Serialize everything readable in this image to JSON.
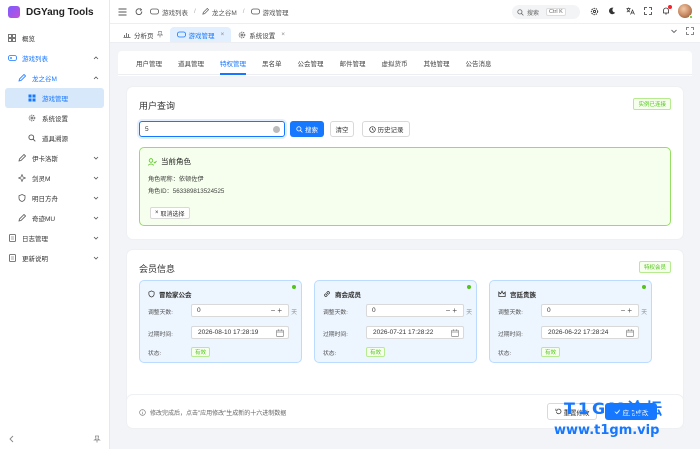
{
  "app": {
    "name": "DGYang Tools"
  },
  "sidebar": {
    "items": [
      {
        "label": "概览"
      },
      {
        "label": "游戏列表"
      },
      {
        "label": "龙之谷M"
      },
      {
        "label": "游戏管理"
      },
      {
        "label": "系统设置"
      },
      {
        "label": "道具溯源"
      },
      {
        "label": "伊卡洛斯"
      },
      {
        "label": "剑灵M"
      },
      {
        "label": "明日方舟"
      },
      {
        "label": "奇迹MU"
      },
      {
        "label": "日志管理"
      },
      {
        "label": "更新说明"
      }
    ]
  },
  "header": {
    "breadcrumb": [
      "游戏列表",
      "龙之谷M",
      "游戏管理"
    ],
    "search": {
      "label": "搜索",
      "shortcut": "Ctrl K"
    }
  },
  "tabs": [
    {
      "label": "分析页"
    },
    {
      "label": "游戏管理"
    },
    {
      "label": "系统设置"
    }
  ],
  "subtabs": [
    "用户管理",
    "道具管理",
    "特权管理",
    "黑名单",
    "公会管理",
    "邮件管理",
    "虚拟货币",
    "其他管理",
    "公告消息"
  ],
  "user_query": {
    "title": "用户查询",
    "badge": "实例已连接",
    "input_value": "5",
    "search_label": "搜索",
    "clear_label": "清空",
    "history_label": "历史记录",
    "current_role": {
      "title": "当前角色",
      "name_line": "角色昵称：依顿佐伊",
      "id_line": "角色ID：563389813524525",
      "cancel_label": "取消选择"
    }
  },
  "member": {
    "title": "会员信息",
    "badge": "特权会员",
    "adjust_label": "调整天数:",
    "expire_label": "过期时间:",
    "status_label": "状态:",
    "unit": "天",
    "cards": [
      {
        "title": "冒险家公会",
        "days": "0",
        "expire": "2026-08-10 17:28:19",
        "status": "有效"
      },
      {
        "title": "商会成员",
        "days": "0",
        "expire": "2026-07-21 17:28:22",
        "status": "有效"
      },
      {
        "title": "宫廷贵族",
        "days": "0",
        "expire": "2026-06-22 17:28:24",
        "status": "有效"
      }
    ]
  },
  "footer": {
    "tip": "修改完成后，点击\"应用修改\"生成新的十六进制数据",
    "reset_label": "重置修改",
    "apply_label": "应用修改"
  },
  "watermark": {
    "line1": "T1GM论坛",
    "line2": "www.t1gm.vip"
  },
  "colors": {
    "primary": "#1677ff",
    "success": "#52c41a",
    "success_bg": "#f6ffed",
    "card_blue": "#edf5fe"
  }
}
